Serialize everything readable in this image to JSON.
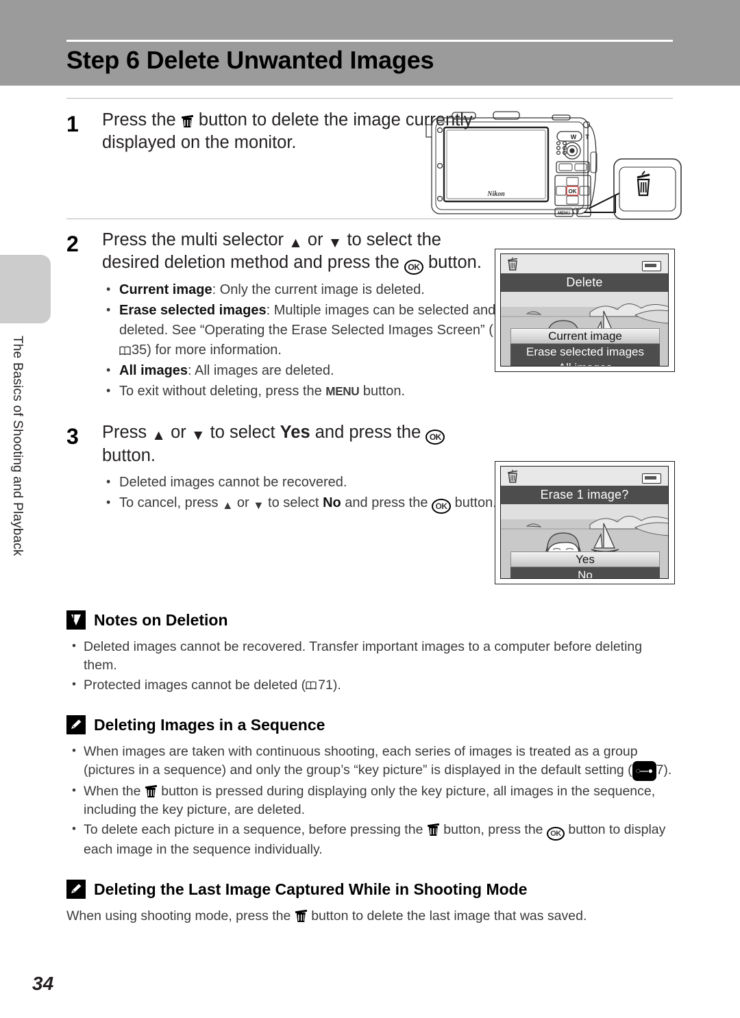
{
  "header": {
    "title": "Step 6 Delete Unwanted Images"
  },
  "sidebar": {
    "chapter_label": "The Basics of Shooting and Playback"
  },
  "page_number": "34",
  "steps": [
    {
      "number": "1",
      "text_parts": {
        "a": "Press the ",
        "b": " button to delete the image currently displayed on the monitor."
      }
    },
    {
      "number": "2",
      "text_parts": {
        "a": "Press the multi selector ",
        "b": " or ",
        "c": " to select the desired deletion method and press the ",
        "d": " button."
      },
      "bullets": [
        {
          "bold": "Current image",
          "rest": ": Only the current image is deleted."
        },
        {
          "bold": "Erase selected images",
          "rest": ": Multiple images can be selected and deleted. See “Operating the Erase Selected Images Screen” (",
          "ref": "35",
          "rest2": ") for more information."
        },
        {
          "bold": "All images",
          "rest": ": All images are deleted."
        },
        {
          "plain_a": "To exit without deleting, press the ",
          "menu": "MENU",
          "plain_b": " button."
        }
      ]
    },
    {
      "number": "3",
      "text_parts": {
        "a": "Press ",
        "b": " or ",
        "c": " to select ",
        "bold": "Yes",
        "d": " and press the ",
        "e": " button."
      },
      "bullets": [
        {
          "plain": "Deleted images cannot be recovered."
        },
        {
          "plain_a": "To cancel, press ",
          "plain_b": " or ",
          "plain_c": " to select ",
          "bold": "No",
          "plain_d": " and press the ",
          "plain_e": " button."
        }
      ]
    }
  ],
  "lcd_delete": {
    "title": "Delete",
    "items": [
      {
        "label": "Current image",
        "selected": true
      },
      {
        "label": "Erase selected images",
        "selected": false
      },
      {
        "label": "All images",
        "selected": false
      }
    ]
  },
  "lcd_confirm": {
    "title": "Erase 1 image?",
    "items": [
      {
        "label": "Yes",
        "selected": true
      },
      {
        "label": "No",
        "selected": false
      }
    ]
  },
  "camera": {
    "zoom_wide": "W",
    "zoom_tele": "T",
    "ok_button": "OK",
    "menu_button": "MENU",
    "brand": "Nikon"
  },
  "notes_deletion": {
    "icon": "caution-icon",
    "title": "Notes on Deletion",
    "bullets": [
      {
        "text_a": "Deleted images cannot be recovered. Transfer important images to a computer before deleting them."
      },
      {
        "text_a": "Protected images cannot be deleted (",
        "ref": "71",
        "text_b": ")."
      }
    ]
  },
  "notes_sequence": {
    "icon": "note-pencil-icon",
    "title": "Deleting Images in a Sequence",
    "bullets": [
      {
        "text_a": "When images are taken with continuous shooting, each series of images is treated as a group (pictures in a sequence) and only the group’s “key picture” is displayed in the default setting (",
        "eref": "7",
        "text_b": ")."
      },
      {
        "text_a": "When the ",
        "text_b": " button is pressed during displaying only the key picture, all images in the sequence, including the key picture,  are deleted."
      },
      {
        "text_a": "To delete each picture in a sequence, before pressing the ",
        "text_b": " button, press the ",
        "text_c": " button to display each image in the sequence individually."
      }
    ]
  },
  "notes_lastimage": {
    "icon": "note-pencil-icon",
    "title": "Deleting the Last Image Captured While in Shooting Mode",
    "body_a": "When using shooting mode, press the ",
    "body_b": " button to delete the last image that was saved."
  }
}
